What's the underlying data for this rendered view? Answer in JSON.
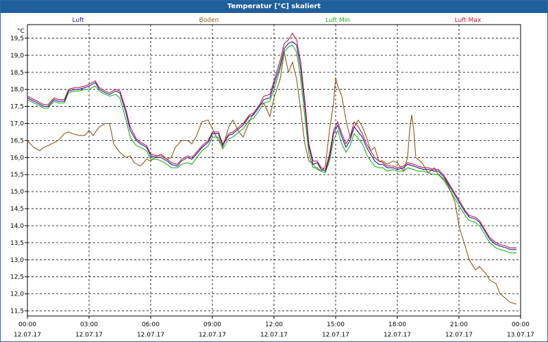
{
  "window": {
    "title": "Temperatur [°C] skaliert"
  },
  "chart_data": {
    "type": "line",
    "title": "Temperatur [°C] skaliert",
    "ylabel": "°C",
    "xlabel": "",
    "ylim": [
      11.35,
      19.9
    ],
    "xlim": [
      0,
      24
    ],
    "grid": true,
    "legend_position": "top",
    "y_ticks": [
      "11,5",
      "12,0",
      "12,5",
      "13,0",
      "13,5",
      "14,0",
      "14,5",
      "15,0",
      "15,5",
      "16,0",
      "16,5",
      "17,0",
      "17,5",
      "18,0",
      "18,5",
      "19,0",
      "19,5"
    ],
    "x_ticks": [
      {
        "time": "00:00",
        "date": "12.07.17"
      },
      {
        "time": "03:00",
        "date": "12.07.17"
      },
      {
        "time": "06:00",
        "date": "12.07.17"
      },
      {
        "time": "09:00",
        "date": "12.07.17"
      },
      {
        "time": "12:00",
        "date": "12.07.17"
      },
      {
        "time": "15:00",
        "date": "12.07.17"
      },
      {
        "time": "18:00",
        "date": "12.07.17"
      },
      {
        "time": "21:00",
        "date": "12.07.17"
      },
      {
        "time": "00:00",
        "date": "13.07.17"
      }
    ],
    "series": [
      {
        "name": "Luft",
        "color": "#1a1aa8",
        "x": [
          0,
          0.5,
          0.8,
          1.0,
          1.3,
          1.5,
          1.8,
          2.0,
          2.3,
          2.5,
          2.8,
          3.0,
          3.3,
          3.5,
          3.8,
          4.0,
          4.3,
          4.5,
          4.8,
          5.0,
          5.3,
          5.5,
          5.8,
          6.0,
          6.3,
          6.5,
          6.8,
          7.0,
          7.3,
          7.5,
          7.8,
          8.0,
          8.3,
          8.5,
          8.8,
          9.0,
          9.3,
          9.5,
          9.8,
          10.0,
          10.3,
          10.5,
          10.8,
          11.0,
          11.3,
          11.5,
          11.8,
          12.0,
          12.3,
          12.5,
          12.7,
          12.9,
          13.1,
          13.3,
          13.5,
          13.7,
          13.9,
          14.1,
          14.3,
          14.5,
          14.7,
          14.9,
          15.1,
          15.3,
          15.5,
          15.7,
          15.9,
          16.1,
          16.3,
          16.5,
          16.7,
          16.9,
          17.1,
          17.3,
          17.5,
          17.8,
          18.0,
          18.3,
          18.5,
          18.8,
          19.0,
          19.3,
          19.5,
          19.8,
          20.0,
          20.3,
          20.5,
          20.8,
          21.0,
          21.3,
          21.5,
          21.8,
          22.0,
          22.3,
          22.5,
          22.8,
          23.0,
          23.3,
          23.5,
          23.8
        ],
        "values": [
          17.75,
          17.6,
          17.5,
          17.5,
          17.7,
          17.65,
          17.65,
          17.95,
          18.0,
          18.0,
          18.05,
          18.1,
          18.2,
          18.0,
          17.9,
          17.85,
          17.95,
          17.9,
          17.3,
          16.8,
          16.5,
          16.4,
          16.3,
          16.05,
          16.0,
          16.0,
          15.9,
          15.8,
          15.75,
          15.9,
          16.0,
          15.95,
          16.15,
          16.3,
          16.45,
          16.7,
          16.7,
          16.35,
          16.65,
          16.7,
          16.85,
          16.95,
          17.2,
          17.25,
          17.5,
          17.7,
          17.75,
          18.15,
          18.7,
          19.2,
          19.35,
          19.4,
          19.3,
          18.6,
          17.5,
          16.3,
          15.8,
          15.85,
          15.65,
          15.6,
          16.0,
          16.7,
          16.95,
          16.6,
          16.3,
          16.5,
          16.9,
          16.75,
          16.6,
          16.3,
          16.1,
          15.9,
          15.8,
          15.8,
          15.7,
          15.7,
          15.65,
          15.7,
          15.8,
          15.75,
          15.7,
          15.65,
          15.65,
          15.6,
          15.6,
          15.4,
          15.2,
          14.9,
          14.7,
          14.4,
          14.25,
          14.2,
          14.1,
          13.8,
          13.6,
          13.45,
          13.4,
          13.35,
          13.3,
          13.3
        ]
      },
      {
        "name": "Boden",
        "color": "#8a5a18",
        "x": [
          0,
          0.3,
          0.6,
          0.8,
          1.0,
          1.5,
          1.8,
          2.0,
          2.2,
          2.5,
          2.8,
          3.0,
          3.2,
          3.5,
          3.8,
          4.0,
          4.2,
          4.5,
          4.8,
          5.0,
          5.2,
          5.5,
          5.8,
          6.0,
          6.2,
          6.5,
          6.8,
          7.0,
          7.2,
          7.5,
          7.8,
          8.0,
          8.2,
          8.5,
          8.8,
          9.0,
          9.2,
          9.5,
          9.8,
          10.0,
          10.3,
          10.5,
          10.8,
          11.0,
          11.3,
          11.5,
          11.8,
          12.0,
          12.3,
          12.5,
          12.7,
          12.9,
          13.1,
          13.3,
          13.5,
          13.7,
          13.9,
          14.1,
          14.3,
          14.5,
          14.7,
          14.9,
          15.0,
          15.1,
          15.3,
          15.5,
          15.7,
          15.9,
          16.1,
          16.3,
          16.5,
          16.7,
          16.9,
          17.1,
          17.3,
          17.5,
          17.8,
          18.0,
          18.3,
          18.5,
          18.6,
          18.7,
          18.8,
          18.9,
          19.0,
          19.2,
          19.5,
          19.8,
          20.0,
          20.3,
          20.5,
          20.8,
          21.0,
          21.3,
          21.5,
          21.8,
          22.0,
          22.3,
          22.5,
          22.8,
          23.0,
          23.3,
          23.5,
          23.8
        ],
        "values": [
          16.5,
          16.3,
          16.2,
          16.3,
          16.35,
          16.5,
          16.7,
          16.75,
          16.7,
          16.65,
          16.65,
          16.8,
          16.65,
          16.9,
          17.0,
          17.0,
          16.4,
          16.15,
          16.0,
          16.05,
          15.85,
          15.75,
          15.95,
          15.9,
          16.0,
          16.1,
          15.95,
          16.0,
          16.3,
          16.5,
          16.5,
          16.4,
          16.6,
          17.05,
          17.1,
          16.85,
          16.6,
          16.3,
          16.9,
          17.1,
          16.75,
          16.6,
          17.05,
          17.3,
          17.55,
          17.6,
          17.2,
          17.75,
          18.3,
          19.1,
          18.5,
          18.8,
          18.3,
          17.4,
          16.4,
          15.9,
          15.8,
          15.65,
          15.6,
          15.75,
          16.8,
          17.6,
          18.35,
          18.1,
          17.8,
          17.1,
          16.6,
          16.9,
          17.1,
          16.9,
          16.6,
          16.2,
          16.3,
          15.9,
          15.9,
          15.8,
          15.9,
          15.85,
          15.6,
          16.0,
          16.8,
          17.25,
          16.8,
          16.0,
          15.95,
          15.85,
          15.55,
          15.7,
          15.5,
          15.35,
          15.15,
          14.7,
          14.0,
          13.4,
          13.0,
          12.7,
          12.8,
          12.6,
          12.4,
          12.3,
          12.0,
          11.85,
          11.75,
          11.7
        ]
      },
      {
        "name": "Luft Min",
        "color": "#19b219",
        "x": [
          0,
          0.5,
          0.8,
          1.0,
          1.3,
          1.5,
          1.8,
          2.0,
          2.3,
          2.5,
          2.8,
          3.0,
          3.3,
          3.5,
          3.8,
          4.0,
          4.3,
          4.5,
          4.8,
          5.0,
          5.3,
          5.5,
          5.8,
          6.0,
          6.3,
          6.5,
          6.8,
          7.0,
          7.3,
          7.5,
          7.8,
          8.0,
          8.3,
          8.5,
          8.8,
          9.0,
          9.3,
          9.5,
          9.8,
          10.0,
          10.3,
          10.5,
          10.8,
          11.0,
          11.3,
          11.5,
          11.8,
          12.0,
          12.3,
          12.5,
          12.7,
          12.9,
          13.1,
          13.3,
          13.5,
          13.7,
          13.9,
          14.1,
          14.3,
          14.5,
          14.7,
          14.9,
          15.1,
          15.3,
          15.5,
          15.7,
          15.9,
          16.1,
          16.3,
          16.5,
          16.7,
          16.9,
          17.1,
          17.3,
          17.5,
          17.8,
          18.0,
          18.3,
          18.5,
          18.8,
          19.0,
          19.3,
          19.5,
          19.8,
          20.0,
          20.3,
          20.5,
          20.8,
          21.0,
          21.3,
          21.5,
          21.8,
          22.0,
          22.3,
          22.5,
          22.8,
          23.0,
          23.3,
          23.5,
          23.8
        ],
        "values": [
          17.7,
          17.55,
          17.45,
          17.45,
          17.65,
          17.6,
          17.6,
          17.9,
          17.95,
          17.95,
          18.0,
          18.0,
          18.1,
          17.95,
          17.85,
          17.8,
          17.85,
          17.75,
          17.1,
          16.6,
          16.35,
          16.3,
          16.2,
          15.95,
          15.95,
          15.9,
          15.8,
          15.7,
          15.7,
          15.8,
          15.85,
          15.8,
          16.05,
          16.2,
          16.35,
          16.6,
          16.6,
          16.25,
          16.55,
          16.6,
          16.75,
          16.85,
          17.1,
          17.15,
          17.4,
          17.6,
          17.65,
          18.0,
          18.6,
          19.1,
          19.25,
          19.3,
          19.1,
          18.3,
          17.2,
          16.1,
          15.7,
          15.7,
          15.6,
          15.55,
          15.9,
          16.5,
          16.8,
          16.4,
          16.15,
          16.35,
          16.7,
          16.55,
          16.4,
          16.1,
          15.9,
          15.75,
          15.7,
          15.7,
          15.6,
          15.65,
          15.6,
          15.6,
          15.7,
          15.65,
          15.6,
          15.6,
          15.55,
          15.5,
          15.5,
          15.3,
          15.1,
          14.8,
          14.6,
          14.3,
          14.15,
          14.1,
          14.0,
          13.7,
          13.5,
          13.35,
          13.3,
          13.25,
          13.2,
          13.2
        ]
      },
      {
        "name": "Luft Max",
        "color": "#c8143c",
        "x": [
          0,
          0.5,
          0.8,
          1.0,
          1.3,
          1.5,
          1.8,
          2.0,
          2.3,
          2.5,
          2.8,
          3.0,
          3.3,
          3.5,
          3.8,
          4.0,
          4.3,
          4.5,
          4.8,
          5.0,
          5.3,
          5.5,
          5.8,
          6.0,
          6.3,
          6.5,
          6.8,
          7.0,
          7.3,
          7.5,
          7.8,
          8.0,
          8.3,
          8.5,
          8.8,
          9.0,
          9.3,
          9.5,
          9.8,
          10.0,
          10.3,
          10.5,
          10.8,
          11.0,
          11.3,
          11.5,
          11.8,
          12.0,
          12.3,
          12.5,
          12.7,
          12.9,
          13.1,
          13.3,
          13.5,
          13.7,
          13.9,
          14.1,
          14.3,
          14.5,
          14.7,
          14.9,
          15.1,
          15.3,
          15.5,
          15.7,
          15.9,
          16.1,
          16.3,
          16.5,
          16.7,
          16.9,
          17.1,
          17.3,
          17.5,
          17.8,
          18.0,
          18.3,
          18.5,
          18.8,
          19.0,
          19.3,
          19.5,
          19.8,
          20.0,
          20.3,
          20.5,
          20.8,
          21.0,
          21.3,
          21.5,
          21.8,
          22.0,
          22.3,
          22.5,
          22.8,
          23.0,
          23.3,
          23.5,
          23.8
        ],
        "values": [
          17.8,
          17.65,
          17.55,
          17.55,
          17.75,
          17.7,
          17.7,
          18.0,
          18.05,
          18.05,
          18.1,
          18.15,
          18.25,
          18.05,
          17.95,
          17.9,
          18.0,
          17.95,
          17.4,
          16.9,
          16.55,
          16.45,
          16.35,
          16.1,
          16.05,
          16.05,
          15.95,
          15.85,
          15.8,
          15.95,
          16.05,
          16.0,
          16.2,
          16.35,
          16.5,
          16.75,
          16.75,
          16.4,
          16.7,
          16.75,
          16.9,
          17.0,
          17.25,
          17.3,
          17.55,
          17.8,
          17.85,
          18.25,
          18.85,
          19.35,
          19.45,
          19.65,
          19.45,
          18.8,
          17.65,
          16.4,
          15.9,
          15.9,
          15.7,
          15.65,
          16.1,
          16.8,
          17.05,
          16.7,
          16.4,
          16.6,
          17.05,
          16.9,
          16.7,
          16.4,
          16.2,
          16.0,
          15.9,
          15.85,
          15.75,
          15.75,
          15.7,
          15.75,
          15.85,
          15.8,
          15.75,
          15.7,
          15.7,
          15.65,
          15.65,
          15.45,
          15.25,
          14.95,
          14.75,
          14.45,
          14.3,
          14.25,
          14.15,
          13.85,
          13.65,
          13.5,
          13.45,
          13.4,
          13.35,
          13.35
        ]
      }
    ]
  }
}
